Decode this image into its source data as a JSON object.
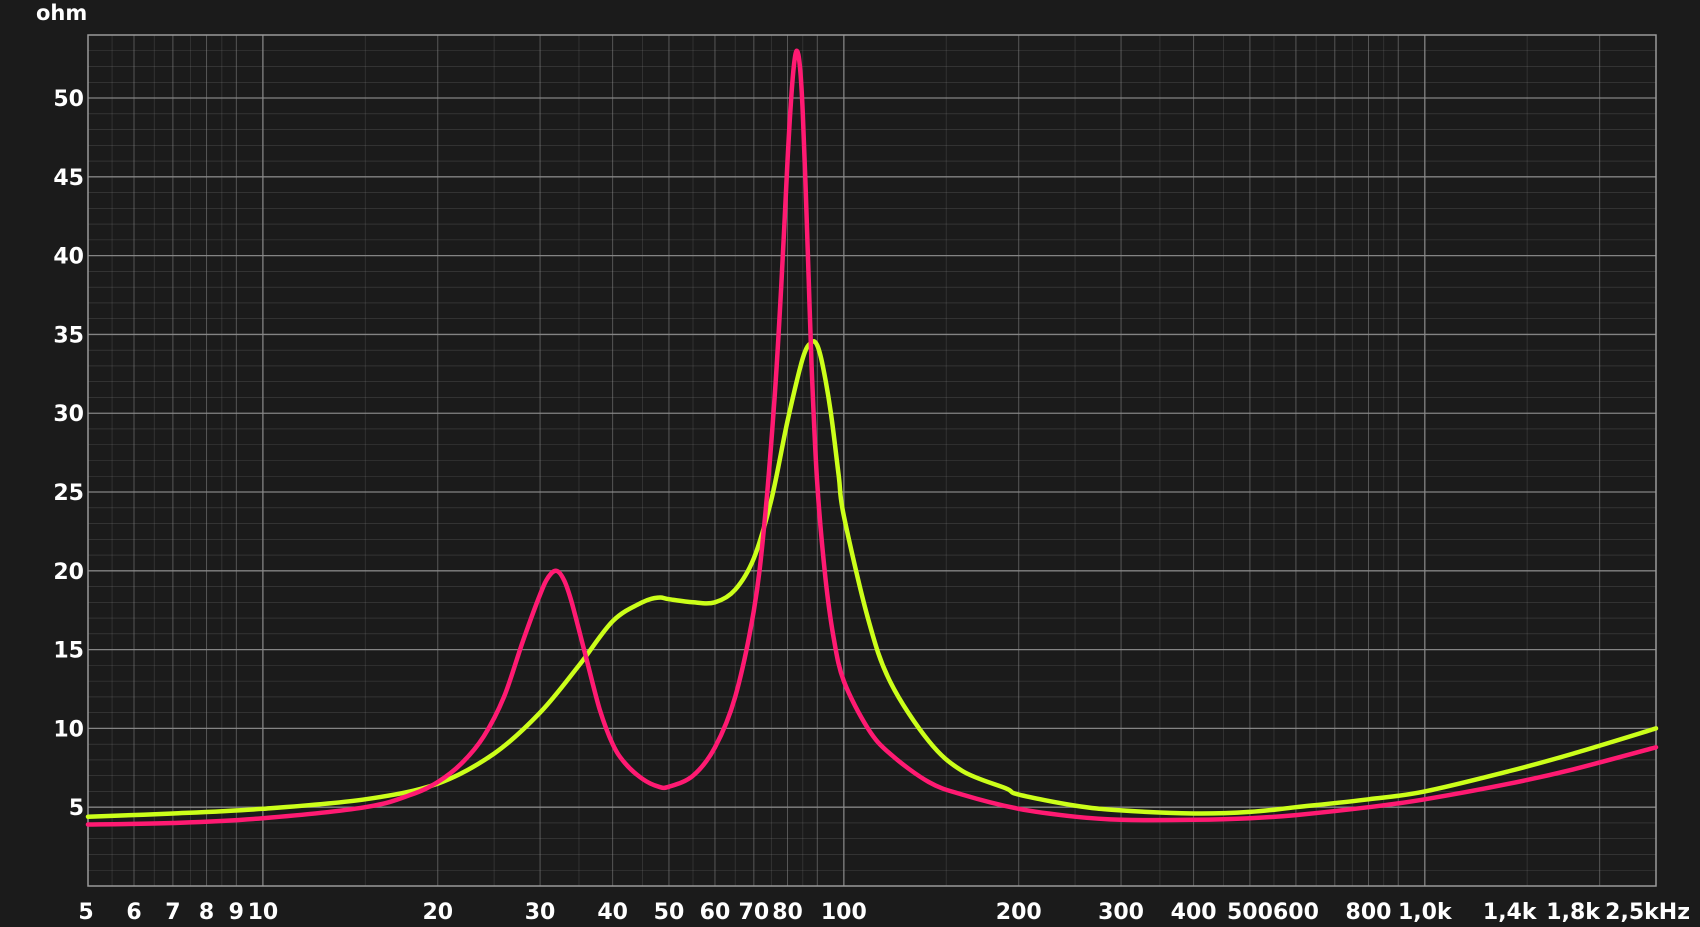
{
  "chart_data": {
    "type": "line",
    "title": "",
    "ylabel": "ohm",
    "xlabel": "",
    "x_scale": "log",
    "xlim": [
      5,
      2500
    ],
    "ylim": [
      0,
      54
    ],
    "grid": true,
    "background": "#1b1b1b",
    "grid_color": "#8a8a8a",
    "y_ticks": [
      {
        "value": 5,
        "label": "5"
      },
      {
        "value": 10,
        "label": "10"
      },
      {
        "value": 15,
        "label": "15"
      },
      {
        "value": 20,
        "label": "20"
      },
      {
        "value": 25,
        "label": "25"
      },
      {
        "value": 30,
        "label": "30"
      },
      {
        "value": 35,
        "label": "35"
      },
      {
        "value": 40,
        "label": "40"
      },
      {
        "value": 45,
        "label": "45"
      },
      {
        "value": 50,
        "label": "50"
      }
    ],
    "x_ticks": [
      {
        "value": 5,
        "label": "5"
      },
      {
        "value": 6,
        "label": "6"
      },
      {
        "value": 7,
        "label": "7"
      },
      {
        "value": 8,
        "label": "8"
      },
      {
        "value": 9,
        "label": "9"
      },
      {
        "value": 10,
        "label": "10"
      },
      {
        "value": 20,
        "label": "20"
      },
      {
        "value": 30,
        "label": "30"
      },
      {
        "value": 40,
        "label": "40"
      },
      {
        "value": 50,
        "label": "50"
      },
      {
        "value": 60,
        "label": "60"
      },
      {
        "value": 70,
        "label": "70"
      },
      {
        "value": 80,
        "label": "80"
      },
      {
        "value": 100,
        "label": "100"
      },
      {
        "value": 200,
        "label": "200"
      },
      {
        "value": 300,
        "label": "300"
      },
      {
        "value": 400,
        "label": "400"
      },
      {
        "value": 500,
        "label": "500"
      },
      {
        "value": 600,
        "label": "600"
      },
      {
        "value": 800,
        "label": "800"
      },
      {
        "value": 1000,
        "label": "1,0k"
      },
      {
        "value": 1400,
        "label": "1,4k"
      },
      {
        "value": 1800,
        "label": "1,8k"
      },
      {
        "value": 2500,
        "label": "2,5kHz"
      }
    ],
    "series": [
      {
        "color": "#ff1a72",
        "x": [
          5,
          7,
          10,
          15,
          18,
          20,
          22,
          24,
          26,
          28,
          30,
          31,
          32,
          33,
          34,
          36,
          38,
          40,
          42,
          45,
          48,
          50,
          55,
          60,
          65,
          70,
          73,
          76,
          78,
          80,
          81,
          82,
          83,
          84,
          85,
          86,
          87,
          88,
          90,
          93,
          96,
          100,
          110,
          120,
          140,
          160,
          200,
          250,
          300,
          400,
          500,
          600,
          800,
          1000,
          1400,
          1800,
          2500
        ],
        "y": [
          3.9,
          4.0,
          4.3,
          5.0,
          5.8,
          6.6,
          7.8,
          9.5,
          12.0,
          15.5,
          18.5,
          19.6,
          20.0,
          19.4,
          18.0,
          14.5,
          11.2,
          9.0,
          7.8,
          6.8,
          6.3,
          6.3,
          7.0,
          8.8,
          12.0,
          17.5,
          23.0,
          31.0,
          38.0,
          46.0,
          49.5,
          52.0,
          53.0,
          52.0,
          49.0,
          44.0,
          38.5,
          33.0,
          25.5,
          19.5,
          15.8,
          13.0,
          10.0,
          8.4,
          6.6,
          5.8,
          4.9,
          4.4,
          4.2,
          4.2,
          4.3,
          4.5,
          5.0,
          5.5,
          6.5,
          7.4,
          8.8
        ]
      },
      {
        "color": "#ccff1a",
        "x": [
          5,
          7,
          10,
          15,
          20,
          25,
          30,
          35,
          40,
          45,
          48,
          50,
          55,
          60,
          65,
          70,
          75,
          80,
          85,
          88,
          90,
          92,
          95,
          98,
          100,
          110,
          120,
          140,
          160,
          190,
          200,
          250,
          300,
          400,
          500,
          600,
          800,
          1000,
          1400,
          1800,
          2500
        ],
        "y": [
          4.4,
          4.6,
          4.9,
          5.5,
          6.5,
          8.4,
          11.0,
          14.0,
          16.8,
          18.0,
          18.3,
          18.2,
          18.0,
          18.0,
          18.8,
          20.8,
          24.5,
          29.5,
          33.5,
          34.5,
          34.3,
          33.0,
          30.0,
          26.0,
          23.5,
          17.0,
          13.0,
          9.2,
          7.3,
          6.2,
          5.8,
          5.1,
          4.8,
          4.6,
          4.7,
          5.0,
          5.5,
          6.0,
          7.3,
          8.4,
          10.0
        ]
      }
    ]
  }
}
